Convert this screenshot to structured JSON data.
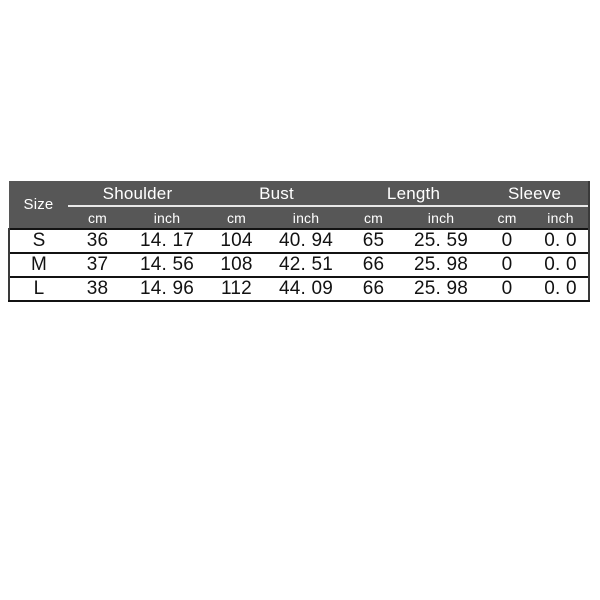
{
  "table": {
    "size_column_label": "Size",
    "groups": [
      {
        "label": "Shoulder"
      },
      {
        "label": "Bust"
      },
      {
        "label": "Length"
      },
      {
        "label": "Sleeve"
      }
    ],
    "units": [
      "cm",
      "inch",
      "cm",
      "inch",
      "cm",
      "inch",
      "cm",
      "inch"
    ],
    "rows": [
      {
        "size": "S",
        "shoulder_cm": "36",
        "shoulder_inch": "14. 17",
        "bust_cm": "104",
        "bust_inch": "40. 94",
        "length_cm": "65",
        "length_inch": "25. 59",
        "sleeve_cm": "0",
        "sleeve_inch": "0. 0"
      },
      {
        "size": "M",
        "shoulder_cm": "37",
        "shoulder_inch": "14. 56",
        "bust_cm": "108",
        "bust_inch": "42. 51",
        "length_cm": "66",
        "length_inch": "25. 98",
        "sleeve_cm": "0",
        "sleeve_inch": "0. 0"
      },
      {
        "size": "L",
        "shoulder_cm": "38",
        "shoulder_inch": "14. 96",
        "bust_cm": "112",
        "bust_inch": "44. 09",
        "length_cm": "66",
        "length_inch": "25. 98",
        "sleeve_cm": "0",
        "sleeve_inch": "0. 0"
      }
    ]
  },
  "colors": {
    "header_background": "#575757",
    "header_text": "#ffffff",
    "body_background": "#ffffff",
    "body_text": "#121212",
    "rule": "#131313",
    "page_background": "#ffffff"
  }
}
